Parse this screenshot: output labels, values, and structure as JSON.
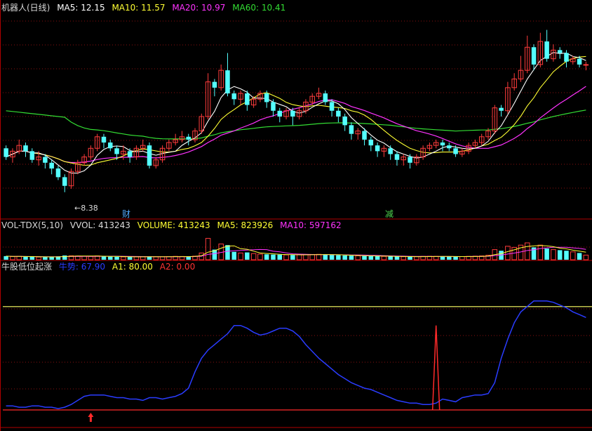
{
  "colors": {
    "background": "#000000",
    "frame": "#b00000",
    "grid": "#8a1010",
    "up": "#ff3c3c",
    "down": "#54ffff",
    "ma5": "#ffffff",
    "ma10": "#ffff33",
    "ma20": "#ff33ff",
    "ma60": "#33dd33",
    "indicator_line": "#2a3cff",
    "signal_line": "#ffff66",
    "spike": "#ff2a2a"
  },
  "main_panel": {
    "title": "机器人(日线)",
    "ma5": "MA5: 12.15",
    "ma10": "MA10: 11.57",
    "ma20": "MA20: 10.97",
    "ma60": "MA60: 10.41",
    "low_annotation": "8.38",
    "event_tag_1": "财",
    "event_tag_2": "减"
  },
  "volume_panel": {
    "title": "VOL-TDX(5,10)",
    "vvol": "VVOL: 413243",
    "volume": "VOLUME: 413243",
    "ma5": "MA5: 823926",
    "ma10": "MA10: 597162"
  },
  "indicator_panel": {
    "title": "牛股低位起涨",
    "line_label": "牛势: 67.90",
    "a1": "A1: 80.00",
    "a2": "A2: 0.00"
  },
  "chart_data": {
    "type": "candlestick+volume+indicator",
    "x_count": 90,
    "price_range": [
      7.5,
      14.5
    ],
    "candles": [
      [
        9.9,
        9.6,
        10.0,
        9.5
      ],
      [
        9.6,
        9.8,
        9.9,
        9.4
      ],
      [
        9.8,
        10.0,
        10.2,
        9.7
      ],
      [
        10.0,
        9.8,
        10.1,
        9.6
      ],
      [
        9.8,
        9.5,
        9.9,
        9.4
      ],
      [
        9.5,
        9.6,
        9.8,
        9.3
      ],
      [
        9.6,
        9.4,
        9.7,
        9.2
      ],
      [
        9.4,
        9.2,
        9.5,
        9.0
      ],
      [
        9.2,
        8.9,
        9.3,
        8.8
      ],
      [
        8.9,
        8.6,
        9.0,
        8.38
      ],
      [
        8.6,
        9.1,
        9.2,
        8.5
      ],
      [
        9.1,
        9.4,
        9.5,
        9.0
      ],
      [
        9.4,
        9.6,
        9.7,
        9.3
      ],
      [
        9.6,
        9.9,
        10.0,
        9.5
      ],
      [
        9.9,
        10.3,
        10.4,
        9.8
      ],
      [
        10.3,
        10.1,
        10.4,
        9.9
      ],
      [
        10.1,
        9.9,
        10.2,
        9.8
      ],
      [
        9.9,
        9.7,
        10.0,
        9.5
      ],
      [
        9.7,
        9.8,
        10.0,
        9.5
      ],
      [
        9.8,
        9.6,
        9.9,
        9.4
      ],
      [
        9.6,
        9.9,
        10.0,
        9.5
      ],
      [
        9.9,
        10.0,
        10.2,
        9.8
      ],
      [
        10.0,
        9.3,
        10.1,
        9.2
      ],
      [
        9.3,
        9.5,
        9.6,
        9.2
      ],
      [
        9.5,
        9.9,
        10.0,
        9.4
      ],
      [
        9.9,
        10.1,
        10.2,
        9.8
      ],
      [
        10.1,
        10.2,
        10.4,
        10.0
      ],
      [
        10.2,
        10.3,
        10.5,
        10.1
      ],
      [
        10.3,
        10.2,
        10.4,
        10.0
      ],
      [
        10.2,
        10.5,
        10.6,
        10.1
      ],
      [
        10.5,
        11.0,
        11.1,
        10.4
      ],
      [
        11.0,
        12.2,
        12.5,
        10.9
      ],
      [
        12.2,
        12.0,
        12.3,
        11.7
      ],
      [
        12.0,
        12.6,
        12.8,
        11.9
      ],
      [
        12.6,
        11.8,
        13.2,
        11.7
      ],
      [
        11.8,
        11.6,
        11.9,
        11.4
      ],
      [
        11.6,
        11.8,
        11.9,
        11.4
      ],
      [
        11.8,
        11.4,
        11.9,
        11.2
      ],
      [
        11.4,
        11.6,
        11.7,
        11.3
      ],
      [
        11.6,
        11.8,
        11.9,
        11.5
      ],
      [
        11.8,
        11.5,
        11.9,
        11.3
      ],
      [
        11.5,
        11.2,
        11.6,
        11.0
      ],
      [
        11.2,
        11.0,
        11.3,
        10.8
      ],
      [
        11.0,
        11.2,
        11.3,
        10.9
      ],
      [
        11.2,
        11.0,
        11.3,
        10.7
      ],
      [
        11.0,
        11.2,
        11.3,
        10.9
      ],
      [
        11.2,
        11.5,
        11.6,
        11.1
      ],
      [
        11.5,
        11.7,
        11.8,
        11.4
      ],
      [
        11.7,
        11.8,
        12.0,
        11.6
      ],
      [
        11.8,
        11.5,
        11.9,
        11.4
      ],
      [
        11.5,
        11.2,
        11.6,
        11.0
      ],
      [
        11.2,
        11.0,
        11.3,
        10.8
      ],
      [
        11.0,
        10.7,
        11.1,
        10.5
      ],
      [
        10.7,
        10.4,
        10.8,
        10.2
      ],
      [
        10.4,
        10.5,
        10.6,
        10.2
      ],
      [
        10.5,
        10.2,
        10.6,
        10.0
      ],
      [
        10.2,
        10.0,
        10.3,
        9.8
      ],
      [
        10.0,
        9.8,
        10.1,
        9.6
      ],
      [
        9.8,
        9.9,
        10.0,
        9.6
      ],
      [
        9.9,
        9.7,
        10.0,
        9.5
      ],
      [
        9.7,
        9.5,
        9.8,
        9.3
      ],
      [
        9.5,
        9.6,
        9.7,
        9.3
      ],
      [
        9.6,
        9.4,
        9.7,
        9.2
      ],
      [
        9.4,
        9.6,
        9.7,
        9.3
      ],
      [
        9.6,
        9.9,
        10.0,
        9.5
      ],
      [
        9.9,
        10.0,
        10.1,
        9.8
      ],
      [
        10.0,
        10.1,
        10.2,
        9.9
      ],
      [
        10.1,
        10.0,
        10.2,
        9.8
      ],
      [
        10.0,
        9.9,
        10.1,
        9.8
      ],
      [
        9.9,
        9.7,
        10.0,
        9.6
      ],
      [
        9.7,
        9.8,
        9.9,
        9.6
      ],
      [
        9.8,
        10.0,
        10.1,
        9.7
      ],
      [
        10.0,
        10.1,
        10.2,
        9.9
      ],
      [
        10.1,
        10.3,
        10.4,
        10.0
      ],
      [
        10.3,
        10.5,
        10.6,
        10.2
      ],
      [
        10.5,
        11.3,
        11.4,
        10.4
      ],
      [
        11.3,
        11.2,
        11.4,
        11.0
      ],
      [
        11.2,
        12.0,
        12.2,
        11.1
      ],
      [
        12.0,
        12.3,
        12.5,
        11.9
      ],
      [
        12.3,
        12.6,
        13.1,
        12.2
      ],
      [
        12.6,
        13.4,
        13.8,
        12.5
      ],
      [
        13.4,
        12.8,
        13.5,
        12.6
      ],
      [
        12.8,
        13.6,
        13.9,
        12.7
      ],
      [
        13.6,
        13.0,
        14.0,
        12.9
      ],
      [
        13.0,
        13.3,
        13.5,
        12.9
      ],
      [
        13.3,
        13.2,
        13.4,
        13.0
      ],
      [
        13.2,
        12.9,
        13.3,
        12.7
      ],
      [
        12.9,
        13.0,
        13.1,
        12.8
      ],
      [
        13.0,
        12.8,
        13.1,
        12.7
      ],
      [
        12.8,
        12.8,
        12.9,
        12.6
      ]
    ],
    "volume_range": [
      0,
      2500000
    ],
    "volumes": [
      320000,
      280000,
      300000,
      260000,
      250000,
      240000,
      230000,
      260000,
      300000,
      380000,
      350000,
      330000,
      310000,
      290000,
      340000,
      300000,
      270000,
      260000,
      250000,
      240000,
      260000,
      270000,
      290000,
      250000,
      260000,
      280000,
      300000,
      290000,
      270000,
      320000,
      600000,
      1900000,
      900000,
      1400000,
      1300000,
      700000,
      600000,
      650000,
      550000,
      500000,
      480000,
      460000,
      450000,
      430000,
      420000,
      440000,
      460000,
      470000,
      480000,
      450000,
      420000,
      400000,
      380000,
      360000,
      350000,
      330000,
      320000,
      310000,
      300000,
      290000,
      280000,
      270000,
      260000,
      270000,
      300000,
      310000,
      300000,
      290000,
      280000,
      270000,
      280000,
      300000,
      320000,
      340000,
      400000,
      900000,
      800000,
      1200000,
      1100000,
      1300000,
      1500000,
      1100000,
      1300000,
      1000000,
      900000,
      850000,
      800000,
      700000,
      600000,
      413243
    ],
    "indicator_range": [
      0,
      100
    ],
    "a1_level": 80,
    "a2_level": 0,
    "indicator_values": [
      3,
      3,
      2,
      2,
      3,
      3,
      2,
      2,
      1,
      2,
      4,
      7,
      10,
      11,
      11,
      11,
      10,
      9,
      9,
      8,
      8,
      7,
      9,
      9,
      8,
      9,
      10,
      12,
      16,
      28,
      38,
      44,
      48,
      52,
      56,
      62,
      62,
      60,
      57,
      55,
      56,
      58,
      60,
      60,
      58,
      54,
      48,
      43,
      38,
      34,
      30,
      26,
      23,
      20,
      18,
      16,
      15,
      13,
      11,
      9,
      7,
      6,
      5,
      5,
      4,
      4,
      5,
      8,
      7,
      6,
      9,
      10,
      11,
      11,
      12,
      20,
      38,
      52,
      64,
      72,
      76,
      80,
      80,
      80,
      79,
      77,
      75,
      72,
      70,
      67.9
    ],
    "spike_index": 66,
    "spike_value": 62,
    "signal_arrow_index": 13
  }
}
